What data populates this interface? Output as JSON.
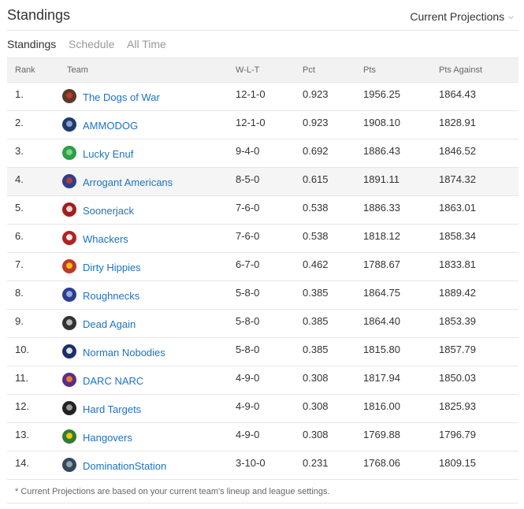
{
  "header": {
    "title": "Standings",
    "projections_label": "Current Projections",
    "projections_icon": "chevron-down-icon"
  },
  "tabs": [
    {
      "label": "Standings",
      "active": true
    },
    {
      "label": "Schedule",
      "active": false
    },
    {
      "label": "All Time",
      "active": false
    }
  ],
  "columns": {
    "rank": "Rank",
    "team": "Team",
    "wlt": "W-L-T",
    "pct": "Pct",
    "pts": "Pts",
    "pts_against": "Pts Against"
  },
  "rows": [
    {
      "rank": "1.",
      "team": "The Dogs of War",
      "wlt": "12-1-0",
      "pct": "0.923",
      "pts": "1956.25",
      "pts_against": "1864.43",
      "logo_colors": [
        "#5a3a2a",
        "#c0392b"
      ]
    },
    {
      "rank": "2.",
      "team": "AMMODOG",
      "wlt": "12-1-0",
      "pct": "0.923",
      "pts": "1908.10",
      "pts_against": "1828.91",
      "logo_colors": [
        "#1f3a6e",
        "#8aa1c8"
      ]
    },
    {
      "rank": "3.",
      "team": "Lucky Enuf",
      "wlt": "9-4-0",
      "pct": "0.692",
      "pts": "1886.43",
      "pts_against": "1846.52",
      "logo_colors": [
        "#2e9e48",
        "#7fd18b"
      ]
    },
    {
      "rank": "4.",
      "team": "Arrogant Americans",
      "wlt": "8-5-0",
      "pct": "0.615",
      "pts": "1891.11",
      "pts_against": "1874.32",
      "logo_colors": [
        "#2a3f8f",
        "#c0392b"
      ]
    },
    {
      "rank": "5.",
      "team": "Soonerjack",
      "wlt": "7-6-0",
      "pct": "0.538",
      "pts": "1886.33",
      "pts_against": "1863.01",
      "logo_colors": [
        "#a61c1c",
        "#d9d9d9"
      ]
    },
    {
      "rank": "6.",
      "team": "Whackers",
      "wlt": "7-6-0",
      "pct": "0.538",
      "pts": "1818.12",
      "pts_against": "1858.34",
      "logo_colors": [
        "#b22222",
        "#f0f0f0"
      ]
    },
    {
      "rank": "7.",
      "team": "Dirty Hippies",
      "wlt": "6-7-0",
      "pct": "0.462",
      "pts": "1788.67",
      "pts_against": "1833.81",
      "logo_colors": [
        "#c0392b",
        "#f1c40f"
      ]
    },
    {
      "rank": "8.",
      "team": "Roughnecks",
      "wlt": "5-8-0",
      "pct": "0.385",
      "pts": "1864.75",
      "pts_against": "1889.42",
      "logo_colors": [
        "#2c3e91",
        "#9fa8da"
      ]
    },
    {
      "rank": "9.",
      "team": "Dead Again",
      "wlt": "5-8-0",
      "pct": "0.385",
      "pts": "1864.40",
      "pts_against": "1853.39",
      "logo_colors": [
        "#333333",
        "#bbbbbb"
      ]
    },
    {
      "rank": "10.",
      "team": "Norman Nobodies",
      "wlt": "5-8-0",
      "pct": "0.385",
      "pts": "1815.80",
      "pts_against": "1857.79",
      "logo_colors": [
        "#1c2f6b",
        "#e0e0e0"
      ]
    },
    {
      "rank": "11.",
      "team": "DARC NARC",
      "wlt": "4-9-0",
      "pct": "0.308",
      "pts": "1817.94",
      "pts_against": "1850.03",
      "logo_colors": [
        "#5b2c8c",
        "#e67e22"
      ]
    },
    {
      "rank": "12.",
      "team": "Hard Targets",
      "wlt": "4-9-0",
      "pct": "0.308",
      "pts": "1816.00",
      "pts_against": "1825.93",
      "logo_colors": [
        "#222222",
        "#999999"
      ]
    },
    {
      "rank": "13.",
      "team": "Hangovers",
      "wlt": "4-9-0",
      "pct": "0.308",
      "pts": "1769.88",
      "pts_against": "1796.79",
      "logo_colors": [
        "#2e7d32",
        "#f1c40f"
      ]
    },
    {
      "rank": "14.",
      "team": "DominationStation",
      "wlt": "3-10-0",
      "pct": "0.231",
      "pts": "1768.06",
      "pts_against": "1809.15",
      "logo_colors": [
        "#34495e",
        "#95a5a6"
      ]
    }
  ],
  "highlight_rank": "4.",
  "footnote": "* Current Projections are based on your current team's lineup and league settings.",
  "colors": {
    "link": "#1a73c8",
    "header_bg": "#f2f2f2",
    "highlight_bg": "#f5f5f5"
  }
}
